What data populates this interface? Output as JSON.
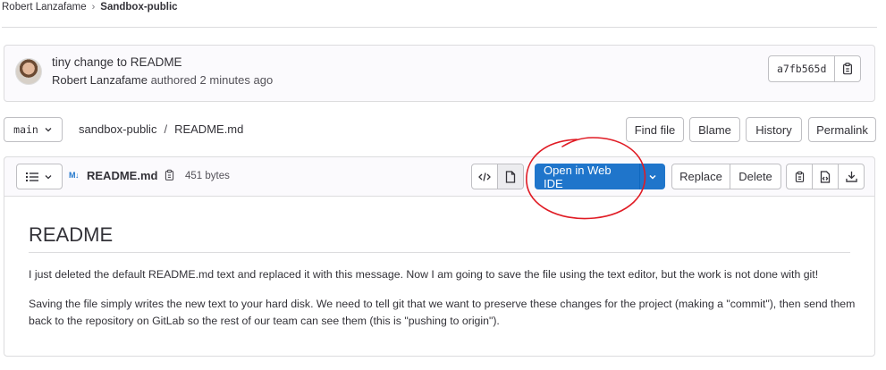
{
  "breadcrumb": {
    "owner": "Robert Lanzafame",
    "project": "Sandbox-public"
  },
  "commit": {
    "title": "tiny change to README",
    "author": "Robert Lanzafame",
    "action": "authored",
    "time": "2 minutes ago",
    "sha": "a7fb565d"
  },
  "nav": {
    "branch": "main",
    "path_root": "sandbox-public",
    "path_sep": "/",
    "path_file": "README.md",
    "buttons": [
      "Find file",
      "Blame",
      "History",
      "Permalink"
    ]
  },
  "file": {
    "md_badge": "M↓",
    "name": "README.md",
    "size": "451 bytes",
    "ide_label": "Open in Web IDE",
    "replace_label": "Replace",
    "delete_label": "Delete"
  },
  "readme": {
    "heading": "README",
    "p1": "I just deleted the default README.md text and replaced it with this message. Now I am going to save the file using the text editor, but the work is not done with git!",
    "p2": "Saving the file simply writes the new text to your hard disk. We need to tell git that we want to preserve these changes for the project (making a \"commit\"), then send them back to the repository on GitLab so the rest of our team can see them (this is \"pushing to origin\")."
  },
  "colors": {
    "primary": "#1f75cb",
    "annotation": "#e01b24"
  }
}
